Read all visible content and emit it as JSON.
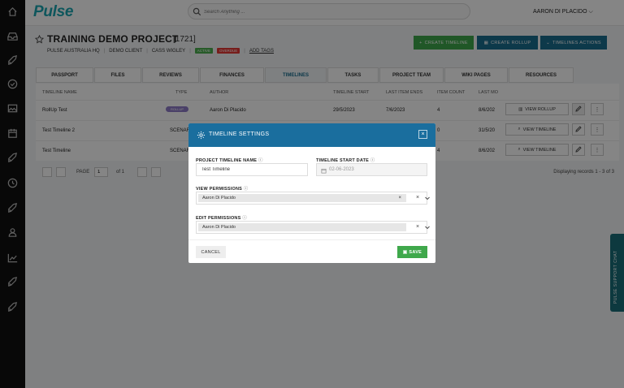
{
  "app": {
    "logo": "Pulse",
    "user": "AARON DI PLACIDO ⌵"
  },
  "search": {
    "placeholder": "Search Anything ...",
    "value": ""
  },
  "sidebar": {
    "icons": [
      "home-icon",
      "inbox-icon",
      "rocket-icon",
      "check-circle-icon",
      "image-icon",
      "calendar-icon",
      "rocket-icon",
      "clock-icon",
      "rocket-icon",
      "person-icon",
      "chart-icon",
      "rocket-icon",
      "rocket-icon"
    ]
  },
  "project": {
    "title": "TRAINING DEMO PROJECT",
    "id": "[1721]",
    "breadcrumbs": [
      "PULSE AUSTRALIA HQ",
      "DEMO CLIENT",
      "CASS WIGLEY"
    ],
    "status_badges": [
      {
        "label": "ACTIVE",
        "color": "#4caf50"
      },
      {
        "label": "OVERDUE",
        "color": "#e53935"
      }
    ],
    "add_tags": "ADD TAGS"
  },
  "header_buttons": {
    "create_timeline": "CREATE TIMELINE",
    "create_rollup": "CREATE ROLLUP",
    "timelines_actions": "TIMELINES ACTIONS"
  },
  "tabs": [
    "PASSPORT",
    "FILES",
    "REVIEWS",
    "FINANCES",
    "TIMELINES",
    "TASKS",
    "PROJECT TEAM",
    "WIKI PAGES",
    "RESOURCES"
  ],
  "table": {
    "headers": [
      "TIMELINE NAME",
      "TYPE",
      "AUTHOR",
      "TIMELINE START",
      "LAST ITEM ENDS",
      "ITEM COUNT",
      "LAST MO"
    ],
    "rows": [
      {
        "name": "RollUp Test",
        "type": "ROLLUP",
        "author": "Aaron Di Placido",
        "start": "29/5/2023",
        "ends": "7/6/2023",
        "count": "4",
        "lastmod": "8/6/202",
        "action": "VIEW ROLLUP"
      },
      {
        "name": "Test Timeline 2",
        "type": "SCENAR",
        "author": "",
        "start": "",
        "ends": "",
        "count": "0",
        "lastmod": "31/5/20",
        "action": "VIEW TIMELINE"
      },
      {
        "name": "Test Timeline",
        "type": "SCENAR",
        "author": "",
        "start": "",
        "ends": "",
        "count": "4",
        "lastmod": "8/6/202",
        "action": "VIEW TIMELINE"
      }
    ]
  },
  "pager": {
    "page_label": "PAGE",
    "page": "1",
    "of": "of 1",
    "display": "Displaying records 1 - 3 of 3"
  },
  "chat": {
    "label": "PULSE SUPPORT CHAT"
  },
  "modal": {
    "title": "TIMELINE SETTINGS",
    "close": "×",
    "name_label": "PROJECT TIMELINE NAME",
    "name_value": "Test Timeline",
    "start_label": "TIMELINE START DATE",
    "start_value": "02-06-2023",
    "view_label": "VIEW PERMISSIONS",
    "view_chip": "Aaron Di Placido",
    "edit_label": "EDIT PERMISSIONS",
    "edit_chip": "Aaron Di Placido",
    "chip_remove": "×",
    "clear": "×",
    "cancel": "CANCEL",
    "save": "SAVE"
  }
}
